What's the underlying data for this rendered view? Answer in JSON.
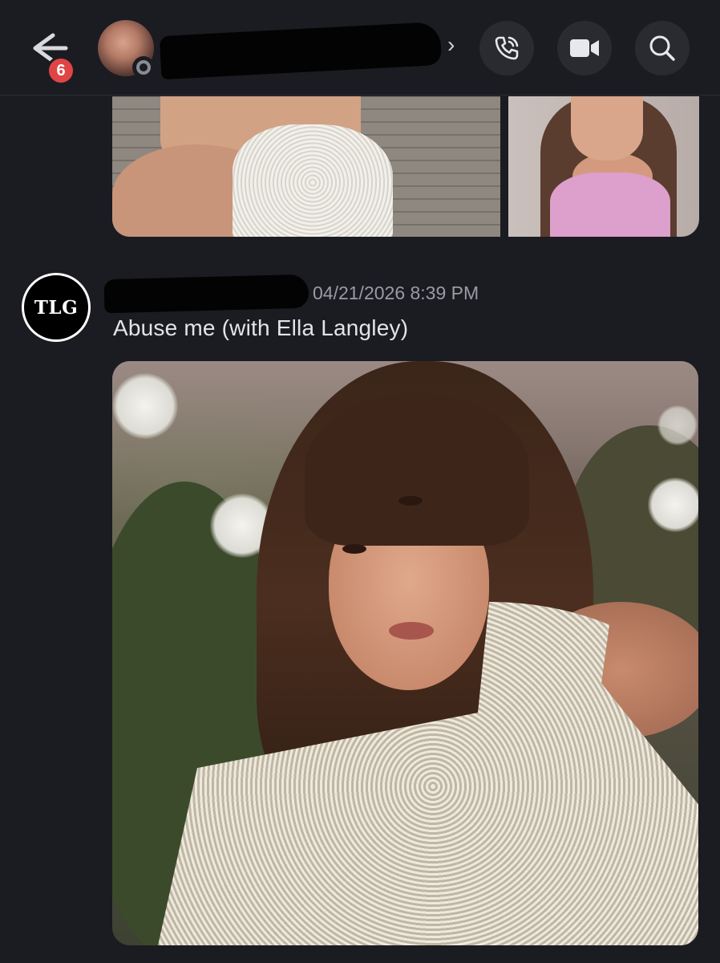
{
  "header": {
    "back_icon": "arrow-left-icon",
    "unread_count": "6",
    "chevron": "›",
    "status": "idle",
    "actions": [
      {
        "name": "voice-call",
        "icon": "phone-icon"
      },
      {
        "name": "video-call",
        "icon": "video-camera-icon"
      },
      {
        "name": "search",
        "icon": "search-icon"
      }
    ]
  },
  "messages": [
    {
      "avatar_text": "TLG",
      "timestamp": "04/21/2026 8:39 PM",
      "text": "Abuse me (with Ella Langley)"
    }
  ],
  "colors": {
    "background": "#1b1c21",
    "button_bg": "#2a2b31",
    "badge": "#e04545",
    "timestamp": "#9a9ba3",
    "text": "#e3e3e8"
  }
}
